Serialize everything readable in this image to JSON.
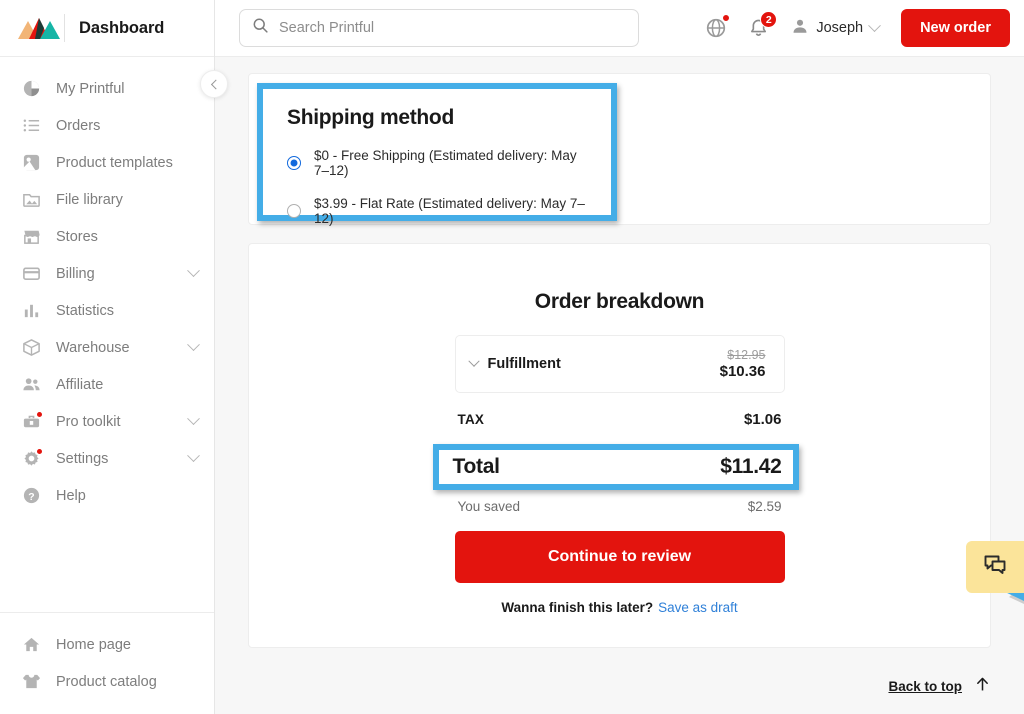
{
  "brand": {
    "title": "Dashboard",
    "logo_icon": "printful-mountains-logo"
  },
  "sidebar": {
    "collapse_icon": "chevron-left-icon",
    "items": [
      {
        "label": "My Printful",
        "icon": "pie-chart-icon",
        "expandable": false,
        "badge": false
      },
      {
        "label": "Orders",
        "icon": "list-icon",
        "expandable": false,
        "badge": false
      },
      {
        "label": "Product templates",
        "icon": "template-icon",
        "expandable": false,
        "badge": false
      },
      {
        "label": "File library",
        "icon": "image-folder-icon",
        "expandable": false,
        "badge": false
      },
      {
        "label": "Stores",
        "icon": "store-icon",
        "expandable": false,
        "badge": false
      },
      {
        "label": "Billing",
        "icon": "credit-card-icon",
        "expandable": true,
        "badge": false
      },
      {
        "label": "Statistics",
        "icon": "bar-chart-icon",
        "expandable": false,
        "badge": false
      },
      {
        "label": "Warehouse",
        "icon": "box-icon",
        "expandable": true,
        "badge": false
      },
      {
        "label": "Affiliate",
        "icon": "people-icon",
        "expandable": false,
        "badge": false
      },
      {
        "label": "Pro toolkit",
        "icon": "toolbox-icon",
        "expandable": true,
        "badge": true
      },
      {
        "label": "Settings",
        "icon": "gear-icon",
        "expandable": true,
        "badge": true
      },
      {
        "label": "Help",
        "icon": "question-circle-icon",
        "expandable": false,
        "badge": false
      }
    ],
    "bottom_items": [
      {
        "label": "Home page",
        "icon": "home-icon"
      },
      {
        "label": "Product catalog",
        "icon": "tshirt-icon"
      }
    ]
  },
  "topbar": {
    "search": {
      "placeholder": "Search Printful",
      "value": "",
      "icon": "search-icon"
    },
    "globe": {
      "icon": "globe-icon",
      "has_dot": true
    },
    "notifications": {
      "icon": "bell-icon",
      "count": "2"
    },
    "user": {
      "name": "Joseph",
      "icon": "user-icon",
      "chevron": "chevron-down-icon"
    },
    "new_order_label": "New order"
  },
  "shipping": {
    "title": "Shipping method",
    "options": [
      {
        "label": "$0 - Free Shipping (Estimated delivery: May 7–12)",
        "selected": true
      },
      {
        "label": "$3.99 - Flat Rate (Estimated delivery: May 7–12)",
        "selected": false
      }
    ]
  },
  "breakdown": {
    "title": "Order breakdown",
    "fulfillment": {
      "label": "Fulfillment",
      "price_original": "$12.95",
      "price_discounted": "$10.36",
      "chevron": "chevron-down-icon"
    },
    "tax": {
      "label": "TAX",
      "value": "$1.06"
    },
    "total": {
      "label": "Total",
      "value": "$11.42"
    },
    "saved": {
      "label": "You saved",
      "value": "$2.59"
    },
    "continue_label": "Continue to review",
    "later_question": "Wanna finish this later?",
    "save_draft_label": "Save as draft"
  },
  "footer": {
    "back_to_top": "Back to top",
    "arrow_icon": "arrow-up-icon"
  },
  "chat": {
    "icon": "chat-bubble-icon"
  },
  "annotations": {
    "highlight_color": "#44ade7",
    "arrow_color": "#44ade7",
    "highlighted_regions": [
      "shipping-method-card",
      "order-total-row"
    ],
    "arrow_points_to": "continue-to-review-button"
  },
  "colors": {
    "brand_red": "#e3140e",
    "link_blue": "#2f80d8",
    "radio_blue": "#1169dd",
    "chat_yellow": "#fbe49a"
  }
}
